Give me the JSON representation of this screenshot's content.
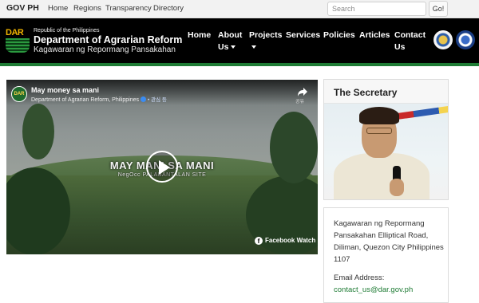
{
  "topbar": {
    "brand": "GOV PH",
    "links": [
      "Home",
      "Regions",
      "Transparency",
      "Directory"
    ],
    "search_placeholder": "Search",
    "go_label": "Go!"
  },
  "header": {
    "logo_text": "DAR",
    "republic": "Republic of the Philippines",
    "agency_name": "Department of Agrarian Reform",
    "agency_filipino": "Kagawaran ng Repormang Pansakahan",
    "nav": {
      "home": "Home",
      "about_1": "About",
      "about_2": "Us",
      "projects": "Projects",
      "services": "Services",
      "policies": "Policies",
      "articles": "Articles",
      "contact_1": "Contact",
      "contact_2": "Us"
    }
  },
  "video": {
    "avatar_text": "DAR",
    "title": "May money sa mani",
    "page_name": "Department of Agrarian Reform, Philippines",
    "follow": "• 관심 등",
    "share_label": "공유",
    "overlay_title": "MAY MANI SA MANI",
    "overlay_sub": "NegOcc PALABANTALAN SITE",
    "watch_label": "Facebook Watch"
  },
  "secretary": {
    "title": "The Secretary"
  },
  "contact": {
    "address": "Kagawaran ng Repormang Pansakahan Elliptical Road, Diliman, Quezon City Philippines 1107",
    "email_label": "Email Address:",
    "email": "contact_us@dar.gov.ph"
  }
}
